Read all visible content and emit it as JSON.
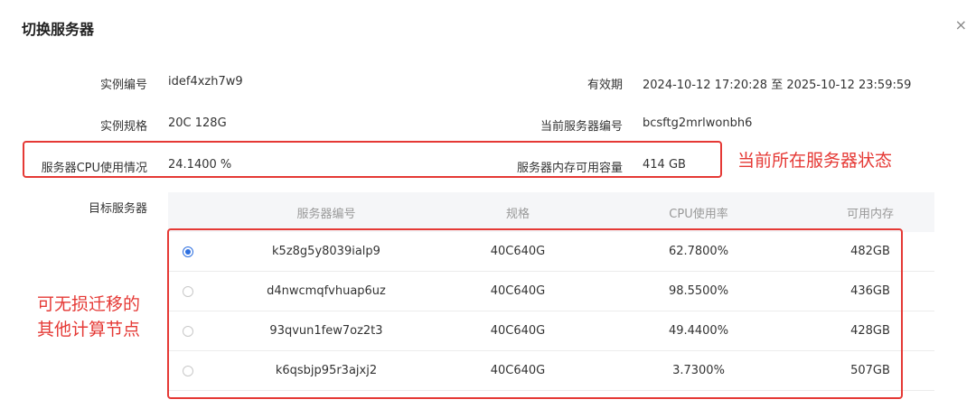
{
  "dialog": {
    "title": "切换服务器",
    "close": "×"
  },
  "info": {
    "instance_id_label": "实例编号",
    "instance_id": "idef4xzh7w9",
    "validity_label": "有效期",
    "validity": "2024-10-12 17:20:28 至 2025-10-12 23:59:59",
    "spec_label": "实例规格",
    "spec": "20C 128G",
    "server_id_label": "当前服务器编号",
    "server_id": "bcsftg2mrlwonbh6",
    "cpu_label": "服务器CPU使用情况",
    "cpu": "24.1400 %",
    "mem_label": "服务器内存可用容量",
    "mem": "414 GB"
  },
  "annotations": {
    "status": "当前所在服务器状态",
    "migrate_line1": "可无损迁移的",
    "migrate_line2": "其他计算节点"
  },
  "target": {
    "label": "目标服务器",
    "headers": [
      "服务器编号",
      "规格",
      "CPU使用率",
      "可用内存"
    ],
    "rows": [
      {
        "id": "k5z8g5y8039ialp9",
        "spec": "40C640G",
        "cpu": "62.7800%",
        "mem": "482GB",
        "selected": true
      },
      {
        "id": "d4nwcmqfvhuap6uz",
        "spec": "40C640G",
        "cpu": "98.5500%",
        "mem": "436GB",
        "selected": false
      },
      {
        "id": "93qvun1few7oz2t3",
        "spec": "40C640G",
        "cpu": "49.4400%",
        "mem": "428GB",
        "selected": false
      },
      {
        "id": "k6qsbjp95r3ajxj2",
        "spec": "40C640G",
        "cpu": "3.7300%",
        "mem": "507GB",
        "selected": false
      }
    ]
  },
  "colors": {
    "annotation": "#e53935",
    "accent": "#2d6fe0",
    "header_bg": "#f5f6f8"
  }
}
